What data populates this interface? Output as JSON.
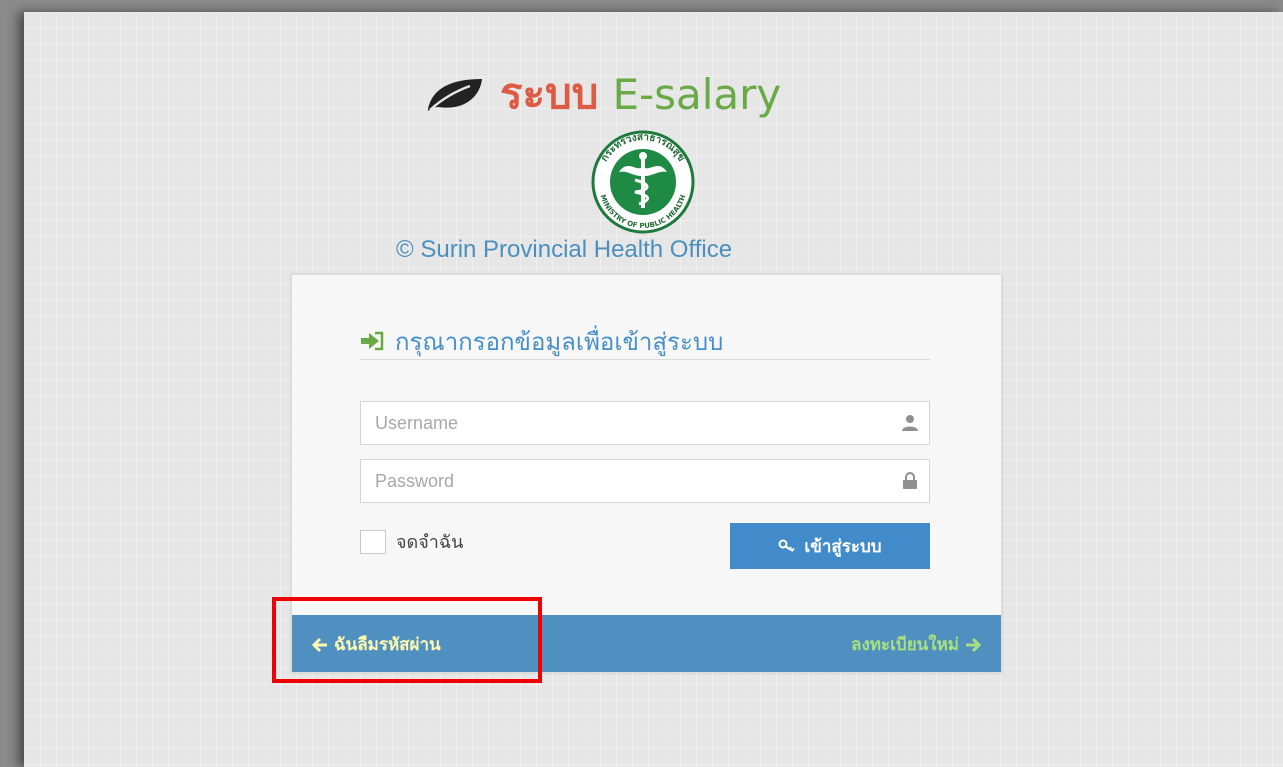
{
  "header": {
    "title_thai": "ระบบ",
    "title_app": "E-salary",
    "seal_top_text": "กระทรวงสาธารณสุข",
    "seal_bottom_text": "MINISTRY OF PUBLIC HEALTH",
    "copyright": "© Surin Provincial Health Office"
  },
  "login": {
    "heading": "กรุณากรอกข้อมูลเพื่อเข้าสู่ระบบ",
    "username_placeholder": "Username",
    "username_value": "",
    "password_placeholder": "Password",
    "password_value": "",
    "remember_label": "จดจำฉัน",
    "remember_checked": false,
    "submit_label": "เข้าสู่ระบบ"
  },
  "toolbar": {
    "forgot_label": "ฉันลืมรหัสผ่าน",
    "register_label": "ลงทะเบียนใหม่"
  },
  "colors": {
    "title_thai": "#dd5a43",
    "title_app": "#69aa46",
    "accent_blue": "#428bca",
    "toolbar_bg": "#5090c1",
    "forgot_text": "#fef9b0",
    "register_text": "#a8e080",
    "highlight": "#f00000"
  },
  "icons": {
    "title": "leaf-icon",
    "heading": "sign-in-icon",
    "username": "user-icon",
    "password": "lock-icon",
    "submit": "key-icon",
    "forgot": "arrow-left-icon",
    "register": "arrow-right-icon"
  }
}
